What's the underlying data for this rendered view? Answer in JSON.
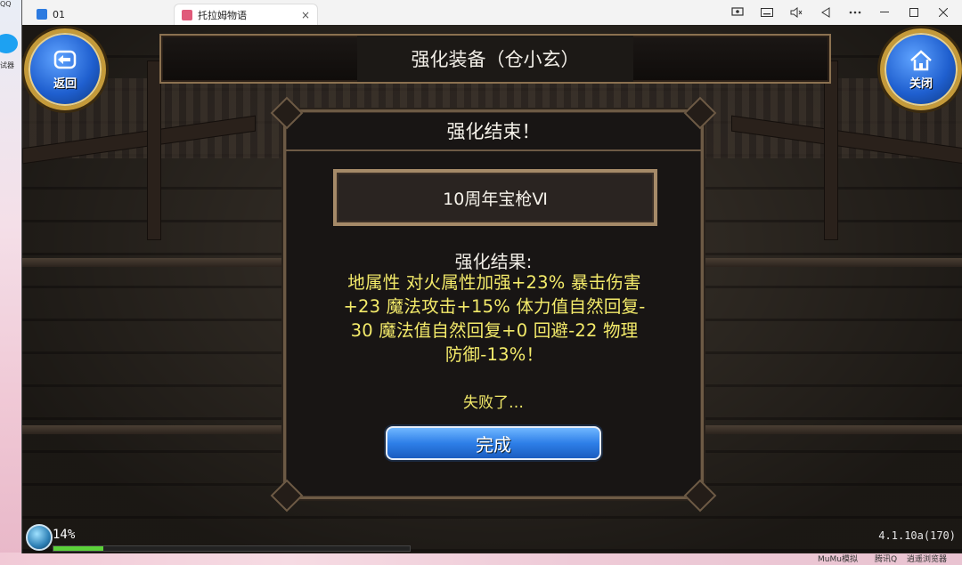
{
  "desktop": {
    "side_labels": [
      "QQ",
      "试器"
    ],
    "taskbar_items": [
      "MuMu模拟",
      "腾讯Q",
      "逍遥浏览器"
    ]
  },
  "window": {
    "tabs": [
      {
        "label": "01",
        "active": false
      },
      {
        "label": "托拉姆物语",
        "active": true
      }
    ],
    "tab_close": "×"
  },
  "game": {
    "back_button": "返回",
    "close_button": "关闭",
    "title": "强化装备（仓小玄）",
    "dialog": {
      "header": "强化结束！",
      "item_name": "10周年宝枪Ⅵ",
      "result_label": "强化结果:",
      "result_lines": [
        "地属性 对火属性加强+23% 暴击伤害",
        "+23 魔法攻击+15% 体力值自然回复-",
        "30 魔法值自然回复+0 回避-22 物理",
        "防御-13%！"
      ],
      "fail_text": "失败了…",
      "done_button": "完成"
    },
    "hud": {
      "progress_percent": "14%",
      "progress_value": 0.14,
      "version": "4.1.10a(170)"
    }
  },
  "colors": {
    "result_text": "#f3ea6a",
    "button_blue": "#2e7fe8",
    "frame": "#6d5a45"
  }
}
